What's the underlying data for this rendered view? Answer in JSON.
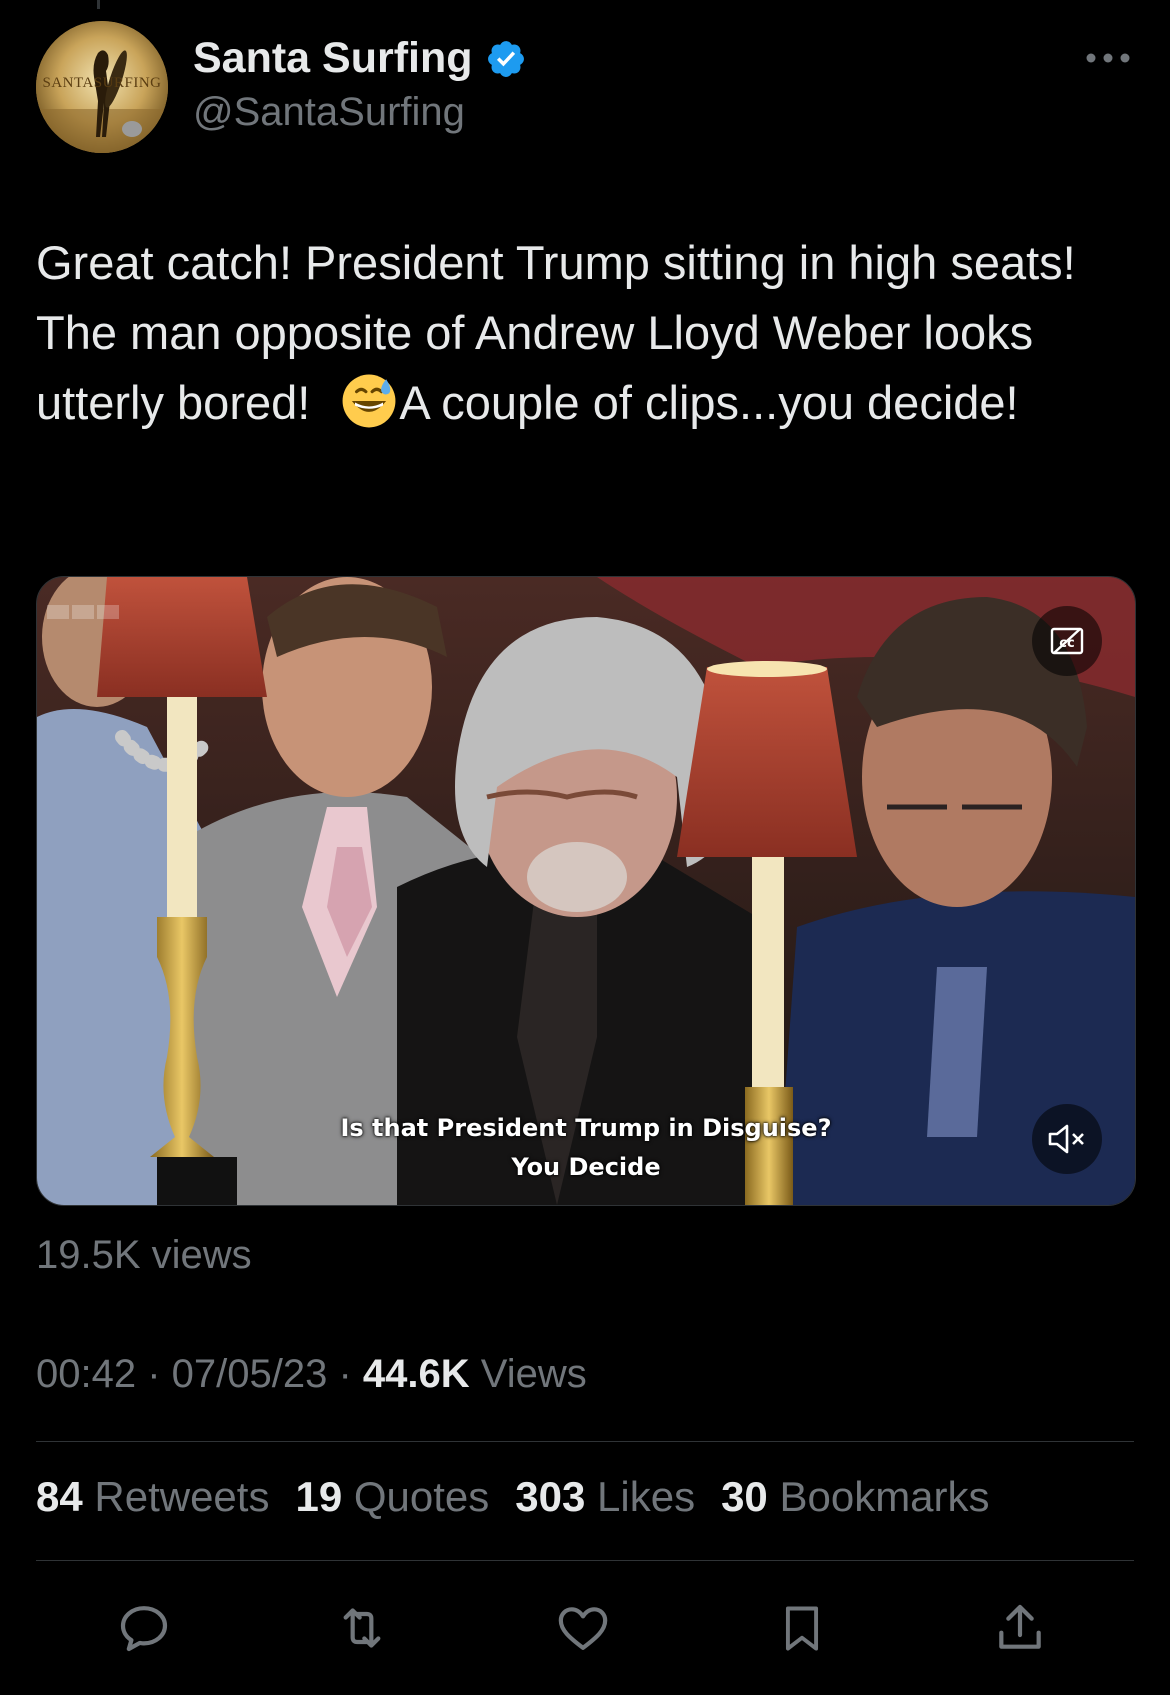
{
  "author": {
    "display_name": "Santa Surfing",
    "handle": "@SantaSurfing",
    "avatar_text": "SANTASURFING",
    "verified": true,
    "verified_color": "#1d9bf0"
  },
  "tweet": {
    "text_part1": "Great catch! President Trump sitting in high seats! The man opposite of Andrew Lloyd Weber looks utterly bored! ",
    "emoji": "grinning-face-with-sweat",
    "text_part2": "A couple of clips...you decide!"
  },
  "media": {
    "caption_line1": "Is that President Trump in Disguise?",
    "caption_line2": "You Decide",
    "cc_icon": "captions-icon",
    "mute_icon": "volume-muted-icon"
  },
  "video_views": "19.5K views",
  "meta": {
    "time": "00:42",
    "separator": " · ",
    "date": "07/05/23",
    "views_count": "44.6K",
    "views_label": " Views"
  },
  "stats": [
    {
      "count": "84",
      "label": " Retweets"
    },
    {
      "count": "19",
      "label": " Quotes"
    },
    {
      "count": "303",
      "label": " Likes"
    },
    {
      "count": "30",
      "label": " Bookmarks"
    }
  ],
  "actions": [
    "reply-icon",
    "retweet-icon",
    "like-icon",
    "bookmark-icon",
    "share-icon"
  ],
  "colors": {
    "background": "#000000",
    "text": "#e7e9ea",
    "secondary": "#71767b",
    "divider": "#2f3336"
  }
}
